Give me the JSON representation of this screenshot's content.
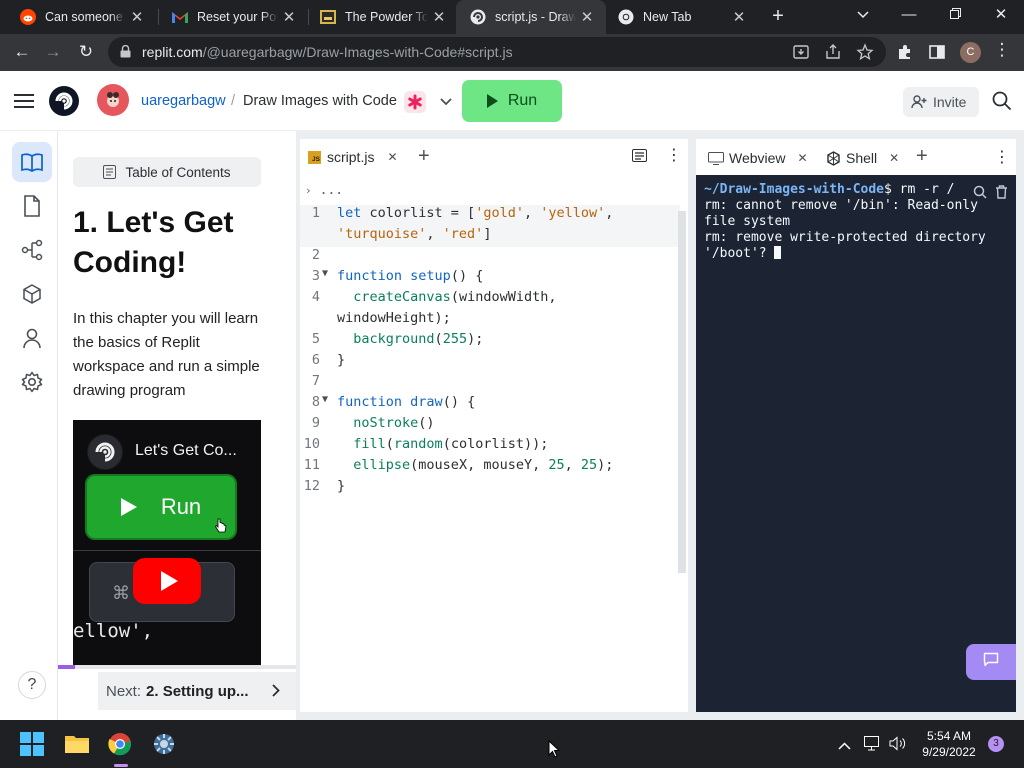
{
  "browser": {
    "tabs": [
      {
        "title": "Can someone pl",
        "icon": "reddit-icon"
      },
      {
        "title": "Reset your Pow",
        "icon": "gmail-icon"
      },
      {
        "title": "The Powder Toy",
        "icon": "powder-toy-icon"
      },
      {
        "title": "script.js - Draw I",
        "icon": "replit-icon"
      },
      {
        "title": "New Tab",
        "icon": "chrome-icon"
      }
    ],
    "url_host": "replit.com",
    "url_path": "/@uaregarbagw/Draw-Images-with-Code#script.js",
    "profile_initial": "C"
  },
  "header": {
    "username": "uaregarbagw",
    "separator": "/",
    "repl_name": "Draw Images with Code",
    "run_label": "Run",
    "invite_label": "Invite",
    "colors": {
      "run_bg": "#6fe686",
      "link": "#0f62c9"
    }
  },
  "lesson": {
    "toc_label": "Table of Contents",
    "title": "1. Let's Get Coding!",
    "body": "In this chapter you will learn the basics of Replit workspace and run a simple drawing program",
    "video": {
      "title": "Let's Get Co...",
      "run_label": "Run",
      "key_label": "⌘ ↵ rn",
      "code_snippet": "ellow',",
      "progress": 0.07
    },
    "next_prefix": "Next:",
    "next_title": "2. Setting up...",
    "help_label": "?"
  },
  "editor": {
    "tab_label": "script.js",
    "tab_badge": "JS",
    "breadcrumb": "...",
    "lines": [
      {
        "n": "1",
        "fold": "",
        "html": "<span class=\"kw\">let</span> colorlist = [<span class=\"str\">'gold'</span>, <span class=\"str\">'yellow'</span>,"
      },
      {
        "n": "",
        "fold": "",
        "html": "<span class=\"str\">'turquoise'</span>, <span class=\"str\">'red'</span>]"
      },
      {
        "n": "2",
        "fold": "",
        "html": ""
      },
      {
        "n": "3",
        "fold": "▼",
        "html": "<span class=\"kw\">function</span> <span class=\"kw\">setup</span>() {"
      },
      {
        "n": "4",
        "fold": "",
        "html": "  <span class=\"num\">createCanvas</span>(windowWidth,"
      },
      {
        "n": "",
        "fold": "",
        "html": "windowHeight);"
      },
      {
        "n": "5",
        "fold": "",
        "html": "  <span class=\"num\">background</span>(<span class=\"num\">255</span>);"
      },
      {
        "n": "6",
        "fold": "",
        "html": "}"
      },
      {
        "n": "7",
        "fold": "",
        "html": ""
      },
      {
        "n": "8",
        "fold": "▼",
        "html": "<span class=\"kw\">function</span> <span class=\"kw\">draw</span>() {"
      },
      {
        "n": "9",
        "fold": "",
        "html": "  <span class=\"num\">noStroke</span>()"
      },
      {
        "n": "10",
        "fold": "",
        "html": "  <span class=\"num\">fill</span>(<span class=\"num\">random</span>(colorlist));"
      },
      {
        "n": "11",
        "fold": "",
        "html": "  <span class=\"num\">ellipse</span>(mouseX, mouseY, <span class=\"num\">25</span>, <span class=\"num\">25</span>);"
      },
      {
        "n": "12",
        "fold": "",
        "html": "}"
      }
    ]
  },
  "console": {
    "tabs": [
      {
        "label": "Webview",
        "icon": "webview-icon"
      },
      {
        "label": "Shell",
        "icon": "shell-icon"
      }
    ],
    "prompt": "~/Draw-Images-with-Code",
    "command": "$ rm -r /",
    "output": [
      "rm: cannot remove '/bin': Read-only",
      "file system",
      "rm: remove write-protected directory",
      " '/boot'? "
    ]
  },
  "taskbar": {
    "time": "5:54 AM",
    "date": "9/29/2022",
    "notification_count": "3",
    "apps": [
      "windows-start-icon",
      "file-explorer-icon",
      "chrome-icon",
      "settings-icon"
    ]
  }
}
